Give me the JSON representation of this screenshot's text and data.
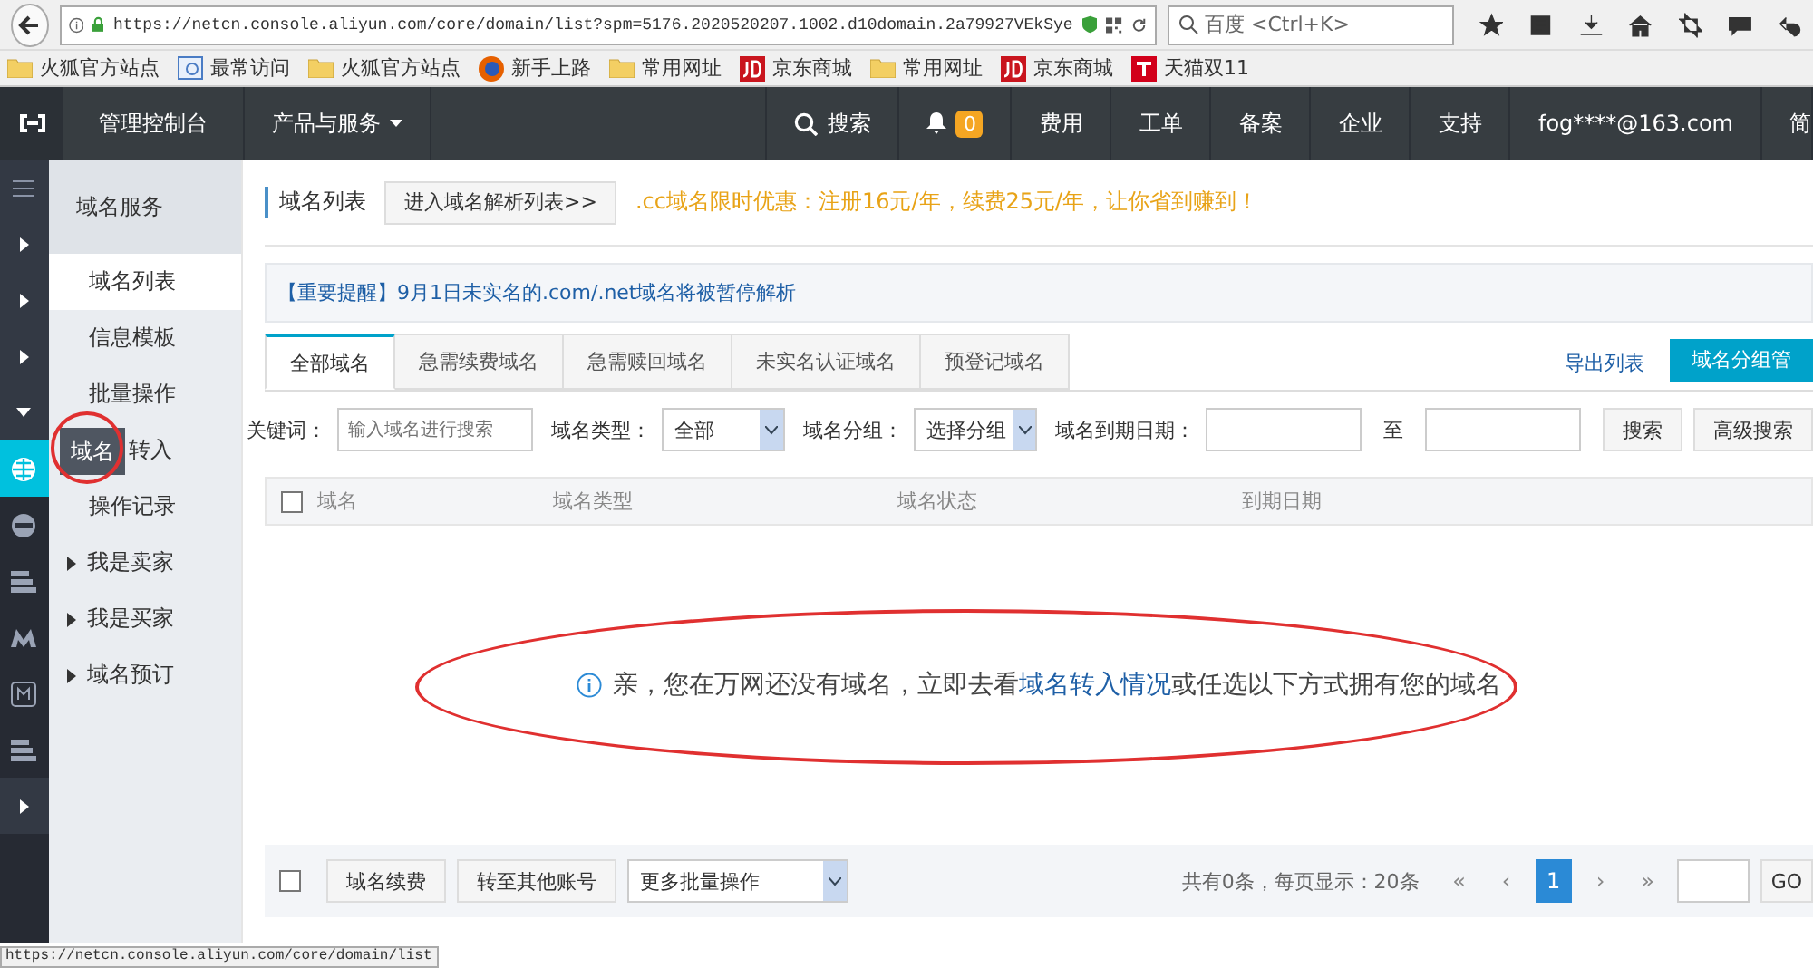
{
  "browser": {
    "url": "https://netcn.console.aliyun.com/core/domain/list?spm=5176.2020520207.1002.d10domain.2a79927VEkSye",
    "search_placeholder": "百度 <Ctrl+K>",
    "bookmarks": [
      {
        "kind": "folder",
        "label": "火狐官方站点"
      },
      {
        "kind": "page",
        "label": "最常访问"
      },
      {
        "kind": "folder",
        "label": "火狐官方站点"
      },
      {
        "kind": "firefox",
        "label": "新手上路"
      },
      {
        "kind": "folder",
        "label": "常用网址"
      },
      {
        "kind": "jd",
        "label": "京东商城"
      },
      {
        "kind": "folder",
        "label": "常用网址"
      },
      {
        "kind": "jd",
        "label": "京东商城"
      },
      {
        "kind": "tmall",
        "label": "天猫双11"
      }
    ]
  },
  "header": {
    "console": "管理控制台",
    "products": "产品与服务",
    "search": "搜索",
    "notifications": "0",
    "nav": [
      "费用",
      "工单",
      "备案",
      "企业",
      "支持"
    ],
    "user": "fog****@163.com",
    "language": "简"
  },
  "rail": [
    {
      "kind": "menu",
      "selected": false
    },
    {
      "kind": "arrow-right",
      "selected": false
    },
    {
      "kind": "arrow-right",
      "selected": false
    },
    {
      "kind": "arrow-right",
      "selected": false
    },
    {
      "kind": "arrow-down",
      "selected": false
    },
    {
      "kind": "globe",
      "selected": true
    },
    {
      "kind": "badge",
      "selected": false
    },
    {
      "kind": "server",
      "selected": false
    },
    {
      "kind": "m",
      "selected": false
    },
    {
      "kind": "frame",
      "selected": false
    },
    {
      "kind": "server",
      "selected": false
    },
    {
      "kind": "arrow-right",
      "selected": false
    }
  ],
  "sidebar": {
    "title": "域名服务",
    "items": [
      {
        "kind": "item",
        "label": "域名列表",
        "selected": true
      },
      {
        "kind": "item",
        "label": "信息模板",
        "selected": false
      },
      {
        "kind": "item",
        "label": "批量操作",
        "selected": false
      },
      {
        "kind": "item",
        "label": "转入",
        "selected": false
      },
      {
        "kind": "item",
        "label": "操作记录",
        "selected": false
      },
      {
        "kind": "group",
        "label": "我是卖家",
        "selected": false
      },
      {
        "kind": "group",
        "label": "我是买家",
        "selected": false
      },
      {
        "kind": "group",
        "label": "域名预订",
        "selected": false
      }
    ],
    "tooltip": "域名"
  },
  "page": {
    "title": "域名列表",
    "dns_button": "进入域名解析列表>>",
    "promo": ".cc域名限时优惠：注册16元/年，续费25元/年，让你省到赚到！",
    "notice": "【重要提醒】9月1日未实名的.com/.net域名将被暂停解析"
  },
  "tabs": [
    {
      "label": "全部域名",
      "selected": true
    },
    {
      "label": "急需续费域名",
      "selected": false
    },
    {
      "label": "急需赎回域名",
      "selected": false
    },
    {
      "label": "未实名认证域名",
      "selected": false
    },
    {
      "label": "预登记域名",
      "selected": false
    }
  ],
  "export_link": "导出列表",
  "group_button": "域名分组管",
  "filters": {
    "keyword_label": "关键词：",
    "keyword_placeholder": "输入域名进行搜索",
    "type_label": "域名类型：",
    "type_value": "全部",
    "group_label": "域名分组：",
    "group_value": "选择分组",
    "date_label": "域名到期日期：",
    "date_to": "至",
    "search_button": "搜索",
    "advanced_button": "高级搜索"
  },
  "table": {
    "select_all": {
      "checked": false
    },
    "columns": [
      "域名",
      "域名类型",
      "域名状态",
      "到期日期"
    ]
  },
  "empty_message": {
    "before": "亲，您在万网还没有域名，立即去看",
    "link": "域名转入情况",
    "after": "或任选以下方式拥有您的域名"
  },
  "footer": {
    "select_all": {
      "checked": false
    },
    "buttons": [
      "域名续费",
      "转至其他账号"
    ],
    "batch_select": "更多批量操作",
    "summary": "共有0条，每页显示：20条",
    "pages": [
      {
        "label": "«",
        "selected": false
      },
      {
        "label": "‹",
        "selected": false
      },
      {
        "label": "1",
        "selected": true
      },
      {
        "label": "›",
        "selected": false
      },
      {
        "label": "»",
        "selected": false
      }
    ],
    "go": "GO"
  },
  "status_url": "https://netcn.console.aliyun.com/core/domain/list"
}
